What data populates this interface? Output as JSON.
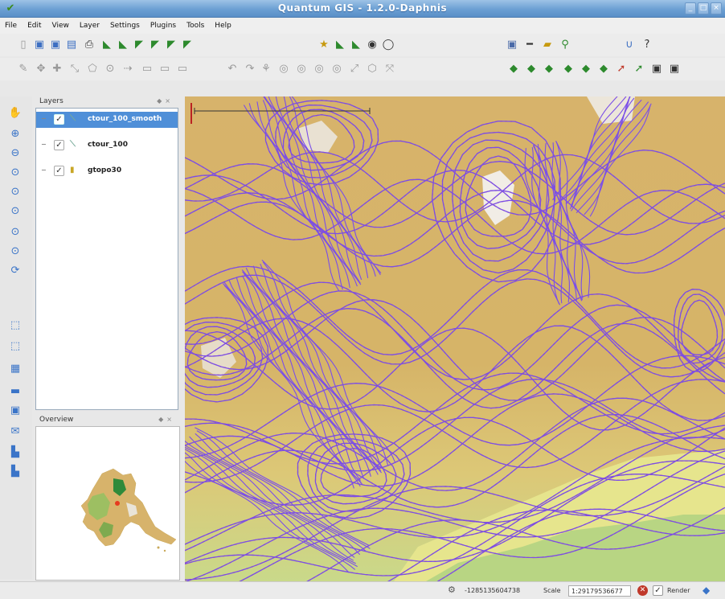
{
  "window": {
    "title": "Quantum GIS - 1.2.0-Daphnis",
    "app_icon": "qgis-logo-icon"
  },
  "menu": [
    "File",
    "Edit",
    "View",
    "Layer",
    "Settings",
    "Plugins",
    "Tools",
    "Help"
  ],
  "layers_panel": {
    "title": "Layers",
    "items": [
      {
        "name": "ctour_100_smooth",
        "checked": true,
        "selected": true,
        "icon": "line-layer-icon"
      },
      {
        "name": "ctour_100",
        "checked": true,
        "selected": false,
        "icon": "line-layer-icon"
      },
      {
        "name": "gtopo30",
        "checked": true,
        "selected": false,
        "icon": "raster-layer-icon"
      }
    ]
  },
  "overview_panel": {
    "title": "Overview"
  },
  "statusbar": {
    "coordinates": "-1285135604738",
    "scale_label": "Scale",
    "scale_value": "1:29179536677",
    "render_label": "Render"
  },
  "colors": {
    "contour_smooth": "#7a4ee8",
    "contour_raw": "#e8452d",
    "terrain_low": "#a9c46a",
    "terrain_mid": "#d5b26a",
    "terrain_high": "#f0ece4",
    "selection": "#4f8fd8"
  }
}
